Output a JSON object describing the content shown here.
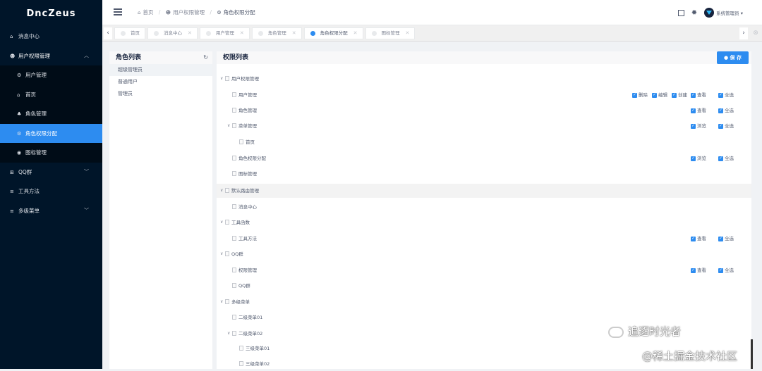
{
  "app": {
    "logo": "DncZeus"
  },
  "sidebar": {
    "items": [
      {
        "icon": "home-icon",
        "glyph": "⌂",
        "label": "消息中心"
      },
      {
        "icon": "user-group-icon",
        "glyph": "☻",
        "label": "用户权限管理",
        "expanded": true
      },
      {
        "icon": "settings-icon",
        "glyph": "⚙",
        "label": "用户管理"
      },
      {
        "icon": "home-icon",
        "glyph": "⌂",
        "label": "首页"
      },
      {
        "icon": "users-icon",
        "glyph": "♣",
        "label": "角色管理"
      },
      {
        "icon": "settings-icon",
        "glyph": "⚙",
        "label": "角色权限分配",
        "active": true
      },
      {
        "icon": "chart-icon",
        "glyph": "◉",
        "label": "图标管理"
      },
      {
        "icon": "grid-icon",
        "glyph": "⊞",
        "label": "QQ群"
      },
      {
        "icon": "list-icon",
        "glyph": "≡",
        "label": "工具方法"
      },
      {
        "icon": "list-icon",
        "glyph": "≡",
        "label": "多级菜单"
      }
    ]
  },
  "header": {
    "breadcrumb": [
      "首页",
      "用户权限管理",
      "角色权限分配"
    ],
    "user_name": "系统管理员"
  },
  "tabs": [
    {
      "label": "首页",
      "closable": false
    },
    {
      "label": "消息中心",
      "closable": true
    },
    {
      "label": "用户管理",
      "closable": true
    },
    {
      "label": "角色管理",
      "closable": true
    },
    {
      "label": "角色权限分配",
      "closable": true,
      "active": true
    },
    {
      "label": "图标管理",
      "closable": true
    }
  ],
  "roles": {
    "title": "角色列表",
    "items": [
      "超级管理员",
      "普通用户",
      "管理员"
    ]
  },
  "permissions": {
    "title": "权限列表",
    "save_label": "保 存",
    "nodes": [
      {
        "label": "用户权限管理",
        "level": 0,
        "expand": true
      },
      {
        "label": "用户管理",
        "level": 1,
        "perms": [
          "删除",
          "编辑",
          "创建",
          "查看",
          "全选"
        ]
      },
      {
        "label": "角色管理",
        "level": 1,
        "perms": [
          "查看",
          "全选"
        ]
      },
      {
        "label": "菜单管理",
        "level": 1,
        "expand": true,
        "perms": [
          "浏览",
          "全选"
        ]
      },
      {
        "label": "首页",
        "level": 2
      },
      {
        "label": "角色权限分配",
        "level": 1,
        "perms": [
          "浏览",
          "全选"
        ]
      },
      {
        "label": "图标管理",
        "level": 1
      },
      {
        "label": "默认路由管理",
        "level": 0,
        "expand": true,
        "highlight": true
      },
      {
        "label": "消息中心",
        "level": 1
      },
      {
        "label": "工具函数",
        "level": 0,
        "expand": true
      },
      {
        "label": "工具方法",
        "level": 1,
        "perms": [
          "查看",
          "全选"
        ]
      },
      {
        "label": "QQ群",
        "level": 0,
        "expand": true
      },
      {
        "label": "权限管理",
        "level": 1,
        "perms": [
          "查看",
          "全选"
        ]
      },
      {
        "label": "QQ群",
        "level": 1
      },
      {
        "label": "多级菜单",
        "level": 0,
        "expand": true
      },
      {
        "label": "二级菜单01",
        "level": 1
      },
      {
        "label": "二级菜单02",
        "level": 1,
        "expand": true
      },
      {
        "label": "三级菜单01",
        "level": 2
      },
      {
        "label": "三级菜单02",
        "level": 2
      }
    ]
  },
  "watermark": {
    "line1": "追逐时光者",
    "line2": "@稀土掘金技术社区"
  },
  "colors": {
    "sidebar_bg": "#001529",
    "accent": "#2d8cf0"
  }
}
